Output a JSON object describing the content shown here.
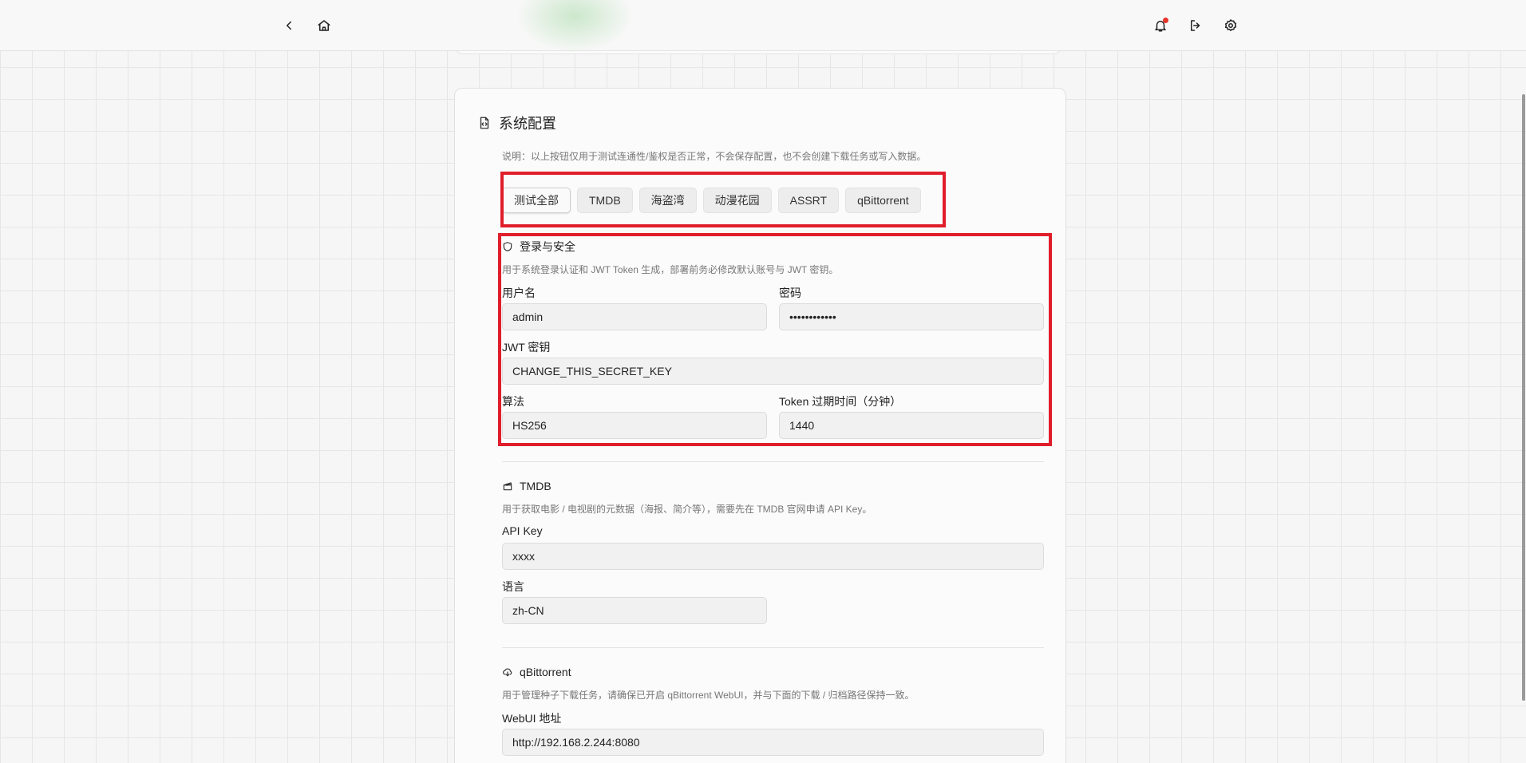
{
  "icons": {
    "back": "chevron-left-icon",
    "home": "home-icon",
    "notifications": "bell-icon",
    "logout": "logout-icon",
    "settings": "gear-icon"
  },
  "colors": {
    "highlight": "#e01e2b",
    "notification_dot": "#e5342a"
  },
  "card": {
    "title": "系统配置",
    "note": "说明：以上按钮仅用于测试连通性/鉴权是否正常，不会保存配置，也不会创建下载任务或写入数据。",
    "test_buttons": [
      "测试全部",
      "TMDB",
      "海盗湾",
      "动漫花园",
      "ASSRT",
      "qBittorrent"
    ]
  },
  "login_security": {
    "title": "登录与安全",
    "description": "用于系统登录认证和 JWT Token 生成，部署前务必修改默认账号与 JWT 密钥。",
    "username_label": "用户名",
    "username_value": "admin",
    "password_label": "密码",
    "password_value": "••••••••••••",
    "jwt_label": "JWT 密钥",
    "jwt_value": "CHANGE_THIS_SECRET_KEY",
    "algorithm_label": "算法",
    "algorithm_value": "HS256",
    "token_expire_label": "Token 过期时间（分钟）",
    "token_expire_value": "1440"
  },
  "tmdb": {
    "title": "TMDB",
    "description": "用于获取电影 / 电视剧的元数据（海报、简介等），需要先在 TMDB 官网申请 API Key。",
    "api_key_label": "API Key",
    "api_key_value": "xxxx",
    "language_label": "语言",
    "language_value": "zh-CN"
  },
  "qbittorrent": {
    "title": "qBittorrent",
    "description": "用于管理种子下载任务，请确保已开启 qBittorrent WebUI，并与下面的下载 / 归档路径保持一致。",
    "webui_label": "WebUI 地址",
    "webui_value": "http://192.168.2.244:8080"
  }
}
